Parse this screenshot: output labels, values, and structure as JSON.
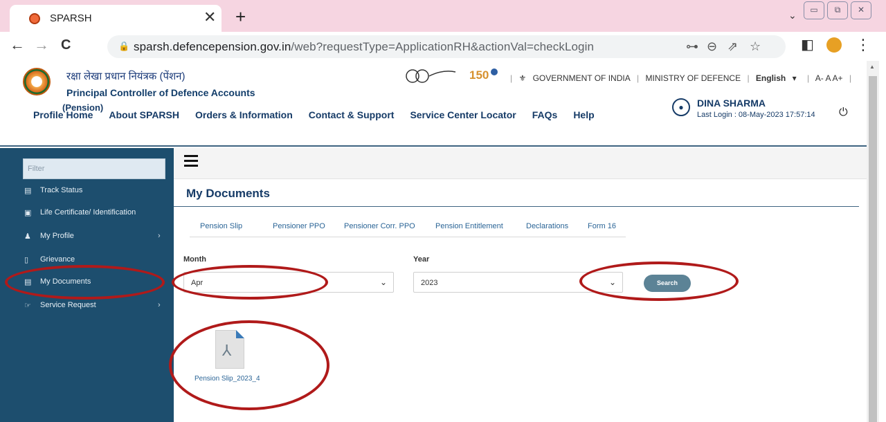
{
  "browser": {
    "tab_title": "SPARSH",
    "close_glyph": "✕",
    "new_tab_glyph": "+",
    "tabs_dropdown_glyph": "⌄",
    "url_host": "sparsh.defencepension.gov.in",
    "url_rest": "/web?requestType=ApplicationRH&actionVal=checkLogin",
    "back_glyph": "←",
    "forward_glyph": "→",
    "reload_glyph": "C",
    "omni_icons": [
      "key-icon",
      "zoom-icon",
      "share-icon",
      "bookmark-star-icon"
    ],
    "key_glyph": "⊶",
    "zoom_glyph": "⊖",
    "share_glyph": "⇗",
    "star_glyph": "☆",
    "sidepanel_glyph": "◧",
    "menu_glyph": "⋮",
    "window_minimize": "▭",
    "window_restore": "⧉",
    "window_close": "✕"
  },
  "header": {
    "hindi_title": "रक्षा लेखा प्रधान नियंत्रक (पेंशन)",
    "org_name": "Principal Controller of Defence Accounts",
    "org_suffix": "(Pension)",
    "government": "GOVERNMENT OF INDIA",
    "ministry": "MINISTRY OF DEFENCE",
    "language": "English",
    "font_sizes": "A- A A+",
    "user_name": "DINA SHARMA",
    "last_login": "Last Login : 08-May-2023 17:57:14",
    "avatar_glyph": "●",
    "power_glyph": "⏻",
    "nav": [
      "Profile Home",
      "About SPARSH",
      "Orders & Information",
      "Contact & Support",
      "Service Center Locator",
      "FAQs",
      "Help"
    ]
  },
  "sidebar": {
    "filter_placeholder": "Filter",
    "items": [
      {
        "label": "Track Status",
        "icon": "▤"
      },
      {
        "label": "Life Certificate/ Identification",
        "icon": "▣"
      },
      {
        "label": "My Profile",
        "icon": "♟",
        "chevron": "›"
      },
      {
        "label": "Grievance",
        "icon": "▯"
      },
      {
        "label": "My Documents",
        "icon": "▤"
      },
      {
        "label": "Service Request",
        "icon": "☞",
        "chevron": "›"
      }
    ]
  },
  "main": {
    "title": "My Documents",
    "doc_tabs": [
      "Pension Slip",
      "Pensioner PPO",
      "Pensioner Corr. PPO",
      "Pension Entitlement",
      "Declarations",
      "Form 16"
    ],
    "month_label": "Month",
    "month_value": "Apr",
    "year_label": "Year",
    "year_value": "2023",
    "caret": "⌄",
    "search_label": "Search",
    "pdf_glyph": "⅄",
    "file_name": "Pension Slip_2023_4"
  },
  "colors": {
    "sidebar_bg": "#1d4e6e",
    "brand_navy": "#163b67",
    "annotation_red": "#b01a1a",
    "tab_strip": "#f6d5e1"
  }
}
